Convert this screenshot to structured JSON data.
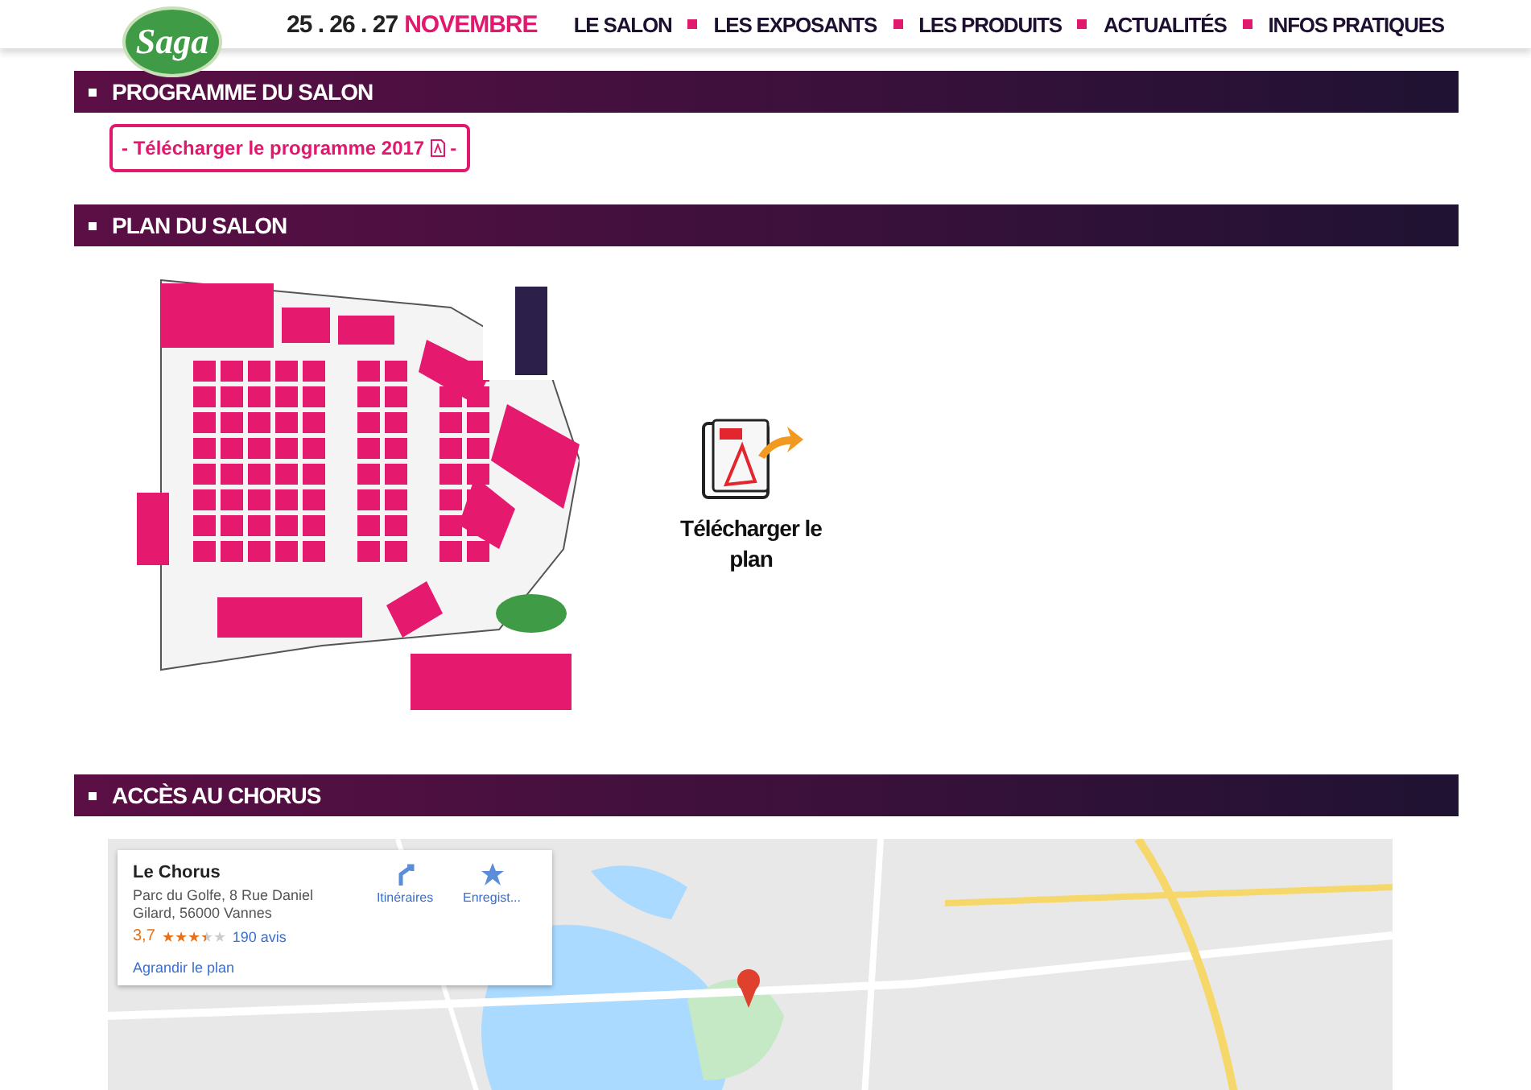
{
  "header": {
    "logo": "Saga",
    "dates": "25 . 26 . 27",
    "month": "NOVEMBRE",
    "nav": [
      {
        "label": "LE SALON"
      },
      {
        "label": "LES EXPOSANTS"
      },
      {
        "label": "LES PRODUITS"
      },
      {
        "label": "ACTUALITÉS"
      },
      {
        "label": "INFOS PRATIQUES"
      }
    ]
  },
  "sections": [
    {
      "kind": "download",
      "title": "PROGRAMME DU SALON",
      "button": "- Télécharger le programme 2017",
      "button_end": "-"
    },
    {
      "kind": "plan",
      "title": "PLAN DU SALON",
      "download": "Télécharger le plan"
    },
    {
      "kind": "map",
      "title": "ACCÈS AU CHORUS",
      "card": {
        "name": "Le Chorus",
        "address": "Parc du Golfe, 8 Rue Daniel Gilard, 56000 Vannes",
        "rating": "3,7",
        "stars": 3.5,
        "reviews": "190 avis",
        "enlarge": "Agrandir le plan",
        "actions": [
          "Itinéraires",
          "Enregist..."
        ]
      }
    }
  ]
}
